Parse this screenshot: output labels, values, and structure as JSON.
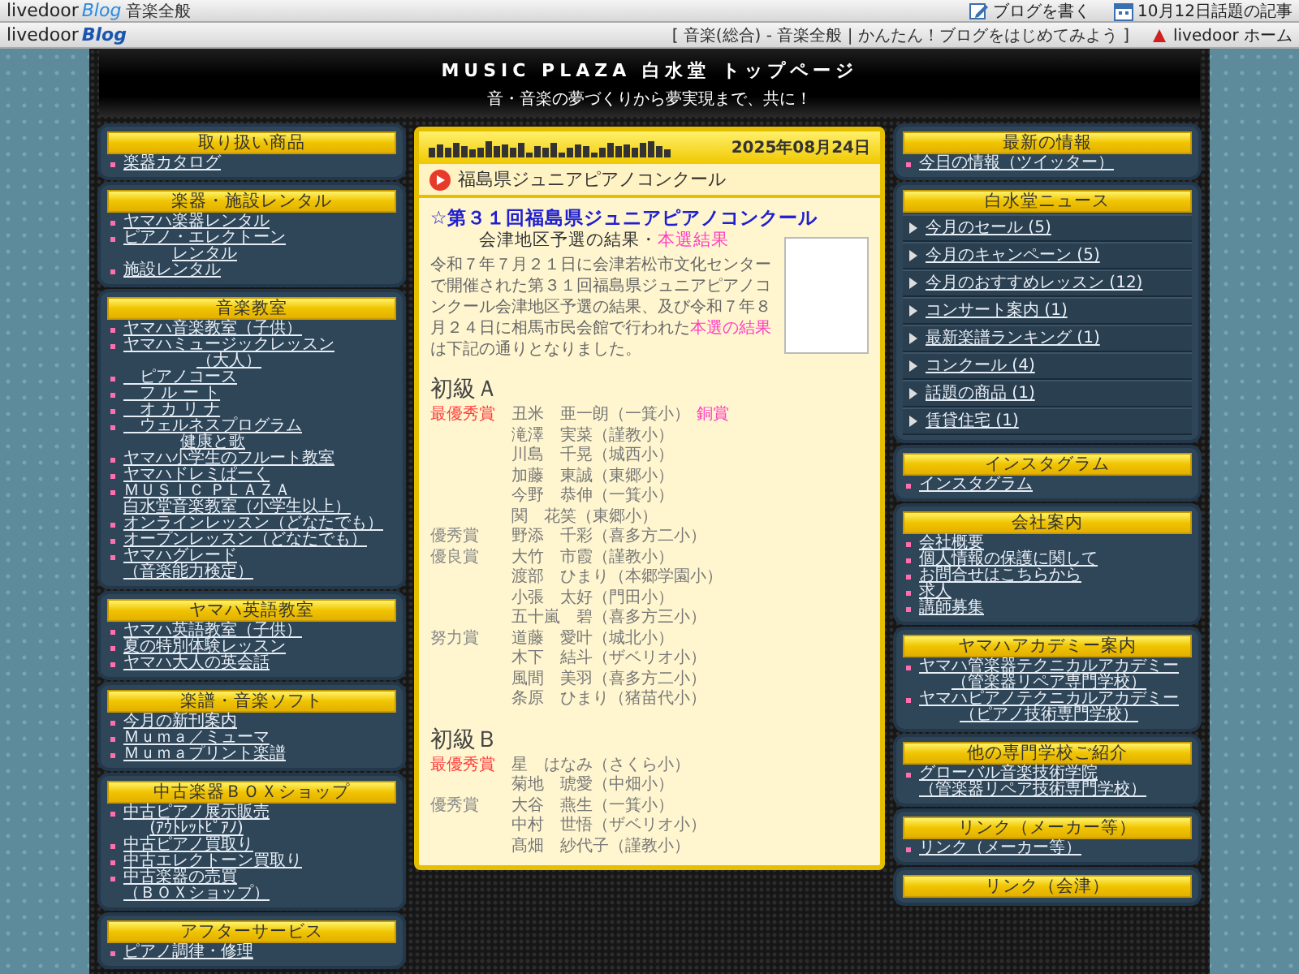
{
  "top_bar": {
    "logo": "livedoor",
    "logo_blog": "Blog",
    "category": "音楽全般",
    "links": [
      {
        "kind": "pen",
        "label": "ブログを書く"
      },
      {
        "kind": "calendar",
        "label": "10月12日話題の記事"
      }
    ]
  },
  "sub_bar": {
    "logo": "livedoor",
    "logo_blog": "Blog",
    "breadcrumb": "[ 音楽(総合) - 音楽全般 | かんたん！ブログをはじめてみよう ]",
    "home_link": "livedoor ホーム"
  },
  "header": {
    "title": "MUSIC PLAZA 白水堂 トップページ",
    "tagline": "音・音楽の夢づくりから夢実現まで、共に！"
  },
  "left_sidebar": [
    {
      "kind": "list",
      "title": "取り扱い商品",
      "items": [
        {
          "lines": [
            "楽器カタログ"
          ]
        }
      ]
    },
    {
      "kind": "list",
      "title": "楽器・施設レンタル",
      "items": [
        {
          "lines": [
            "ヤマハ楽器レンタル"
          ]
        },
        {
          "lines": [
            "ピアノ・エレクトーン",
            "レンタル"
          ]
        },
        {
          "lines": [
            "施設レンタル"
          ]
        }
      ]
    },
    {
      "kind": "list",
      "title": "音楽教室",
      "items": [
        {
          "lines": [
            "ヤマハ音楽教室（子供）"
          ]
        },
        {
          "lines": [
            "ヤマハミュージックレッスン",
            "（大人）"
          ]
        },
        {
          "lines": [
            "　ピアノコース"
          ]
        },
        {
          "lines": [
            "　フ ル ー ト"
          ]
        },
        {
          "lines": [
            "　オ カ リ ナ"
          ]
        },
        {
          "lines": [
            "　ウェルネスプログラム",
            "健康と歌"
          ]
        },
        {
          "lines": [
            "ヤマハ小学生のフルート教室"
          ]
        },
        {
          "lines": [
            "ヤマハドレミぱーく"
          ]
        },
        {
          "lines": [
            "ＭＵＳＩＣ ＰＬＡＺＡ",
            "白水堂音楽教室（小学生以上）"
          ]
        },
        {
          "lines": [
            "オンラインレッスン（どなたでも）"
          ]
        },
        {
          "lines": [
            "オープンレッスン（どなたでも）"
          ]
        },
        {
          "lines": [
            "ヤマハグレード",
            "（音楽能力検定）"
          ]
        }
      ]
    },
    {
      "kind": "list",
      "title": "ヤマハ英語教室",
      "items": [
        {
          "lines": [
            "ヤマハ英語教室（子供）"
          ]
        },
        {
          "lines": [
            "夏の特別体験レッスン"
          ]
        },
        {
          "lines": [
            "ヤマハ大人の英会話"
          ]
        }
      ]
    },
    {
      "kind": "list",
      "title": "楽譜・音楽ソフト",
      "items": [
        {
          "lines": [
            "今月の新刊案内"
          ]
        },
        {
          "lines": [
            "Ｍｕｍａ／ミューマ"
          ]
        },
        {
          "lines": [
            "Ｍｕｍａプリント楽譜"
          ]
        }
      ]
    },
    {
      "kind": "list",
      "title": "中古楽器ＢＯＸショップ",
      "items": [
        {
          "lines": [
            "中古ピアノ展示販売",
            "(ｱｳﾄﾚｯﾄﾋﾟｱﾉ)"
          ]
        },
        {
          "lines": [
            "中古ピアノ買取り"
          ]
        },
        {
          "lines": [
            "中古エレクトーン買取り"
          ]
        },
        {
          "lines": [
            "中古楽器の売買",
            "（ＢＯＸショップ）"
          ]
        }
      ]
    },
    {
      "kind": "list",
      "title": "アフターサービス",
      "items": [
        {
          "lines": [
            "ピアノ調律・修理"
          ]
        }
      ]
    }
  ],
  "post": {
    "date": "2025年08月24日",
    "title": "福島県ジュニアピアノコンクール",
    "heading": "☆第３１回福島県ジュニアピアノコンクール",
    "subheading": "会津地区予選の結果・",
    "subheading_link": "本選結果",
    "paragraph_before": "令和７年７月２１日に会津若松市文化センターで開催された第３１回福島県ジュニアピアノコンクール会津地区予選の結果、及び令和７年８月２４日に相馬市民会館で行われた",
    "paragraph_link": "本選の結果",
    "paragraph_after": "は下記の通りとなりました。",
    "sections": [
      {
        "title": "初級Ａ",
        "rows": [
          {
            "award": "最優秀賞",
            "color": "#ff3b3b",
            "name": "丑米　亜一朗（一箕小）",
            "note": "銅賞"
          },
          {
            "name": "滝澤　実菜（謹教小）"
          },
          {
            "name": "川島　千晃（城西小）"
          },
          {
            "name": "加藤　東誠（東郷小）"
          },
          {
            "name": "今野　恭伸（一箕小）"
          },
          {
            "name": "関　花笑（東郷小）"
          },
          {
            "award": "優秀賞",
            "color": "#888888",
            "name": "野添　千彩（喜多方二小）"
          },
          {
            "award": "優良賞",
            "color": "#888888",
            "name": "大竹　市霞（謹教小）"
          },
          {
            "name": "渡部　ひまり（本郷学園小）"
          },
          {
            "name": "小張　太好（門田小）"
          },
          {
            "name": "五十嵐　碧（喜多方三小）"
          },
          {
            "award": "努力賞",
            "color": "#888888",
            "name": "道藤　愛叶（城北小）"
          },
          {
            "name": "木下　結斗（ザベリオ小）"
          },
          {
            "name": "風間　美羽（喜多方二小）"
          },
          {
            "name": "条原　ひまり（猪苗代小）"
          }
        ]
      },
      {
        "title": "初級Ｂ",
        "rows": [
          {
            "award": "最優秀賞",
            "color": "#ff3b3b",
            "name": "星　はなみ（さくら小）"
          },
          {
            "name": "菊地　琥愛（中畑小）"
          },
          {
            "award": "優秀賞",
            "color": "#888888",
            "name": "大谷　燕生（一箕小）"
          },
          {
            "name": "中村　世悟（ザベリオ小）"
          },
          {
            "name": "髙畑　紗代子（謹教小）"
          }
        ]
      }
    ]
  },
  "right_sidebar": [
    {
      "kind": "list",
      "title": "最新の情報",
      "items": [
        {
          "lines": [
            "今日の情報（ツイッター）"
          ]
        }
      ]
    },
    {
      "kind": "news",
      "title": "白水堂ニュース",
      "items": [
        {
          "lines": [
            "今月のセール (5)"
          ]
        },
        {
          "lines": [
            "今月のキャンペーン (5)"
          ]
        },
        {
          "lines": [
            "今月のおすすめレッスン (12)"
          ]
        },
        {
          "lines": [
            "コンサート案内 (1)"
          ]
        },
        {
          "lines": [
            "最新楽譜ランキング (1)"
          ]
        },
        {
          "lines": [
            "コンクール (4)"
          ]
        },
        {
          "lines": [
            "話題の商品 (1)"
          ]
        },
        {
          "lines": [
            "賃貸住宅 (1)"
          ]
        }
      ]
    },
    {
      "kind": "list",
      "title": "インスタグラム",
      "items": [
        {
          "lines": [
            "インスタグラム"
          ]
        }
      ]
    },
    {
      "kind": "list",
      "title": "会社案内",
      "items": [
        {
          "lines": [
            "会社概要"
          ]
        },
        {
          "lines": [
            "個人情報の保護に関して"
          ]
        },
        {
          "lines": [
            "お問合せはこちらから"
          ]
        },
        {
          "lines": [
            "求人"
          ]
        },
        {
          "lines": [
            "講師募集"
          ]
        }
      ]
    },
    {
      "kind": "list",
      "title": "ヤマハアカデミー案内",
      "items": [
        {
          "lines": [
            "ヤマハ管楽器テクニカルアカデミー",
            "（管楽器リペア専門学校）"
          ]
        },
        {
          "lines": [
            "ヤマハピアノテクニカルアカデミー",
            "（ピアノ技術専門学校）"
          ]
        }
      ]
    },
    {
      "kind": "list",
      "title": "他の専門学校ご紹介",
      "items": [
        {
          "lines": [
            "グローバル音楽技術学院",
            "（管楽器リペア技術専門学校）"
          ]
        }
      ]
    },
    {
      "kind": "list",
      "title": "リンク（メーカー等）",
      "items": [
        {
          "lines": [
            "リンク（メーカー等）"
          ]
        }
      ]
    },
    {
      "title": "リンク（会津）"
    }
  ]
}
